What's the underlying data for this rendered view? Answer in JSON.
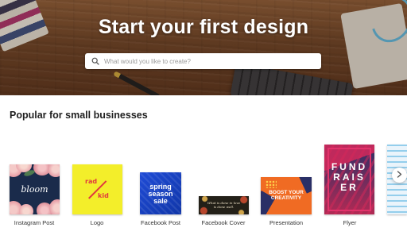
{
  "hero": {
    "title": "Start your first design",
    "search": {
      "placeholder": "What would you like to create?",
      "value": ""
    }
  },
  "section": {
    "title": "Popular for small businesses"
  },
  "templates": [
    {
      "label": "Instagram Post",
      "preview_text": [
        "bloom"
      ]
    },
    {
      "label": "Logo",
      "preview_text": [
        "rad",
        "kid"
      ]
    },
    {
      "label": "Facebook Post",
      "preview_text": [
        "spring",
        "season",
        "sale"
      ]
    },
    {
      "label": "Facebook Cover",
      "preview_text": [
        "What is done in love",
        "is done well."
      ]
    },
    {
      "label": "Presentation",
      "preview_text": [
        "BOOST YOUR",
        "CREATIVITY"
      ]
    },
    {
      "label": "Flyer",
      "preview_text": [
        "FUND",
        "RAIS",
        "ER"
      ]
    }
  ],
  "icons": {
    "search": "search-icon",
    "next": "chevron-right-icon"
  },
  "colors": {
    "hero_text": "#ffffff",
    "section_title": "#1f1f1f",
    "label_text": "#333333"
  }
}
